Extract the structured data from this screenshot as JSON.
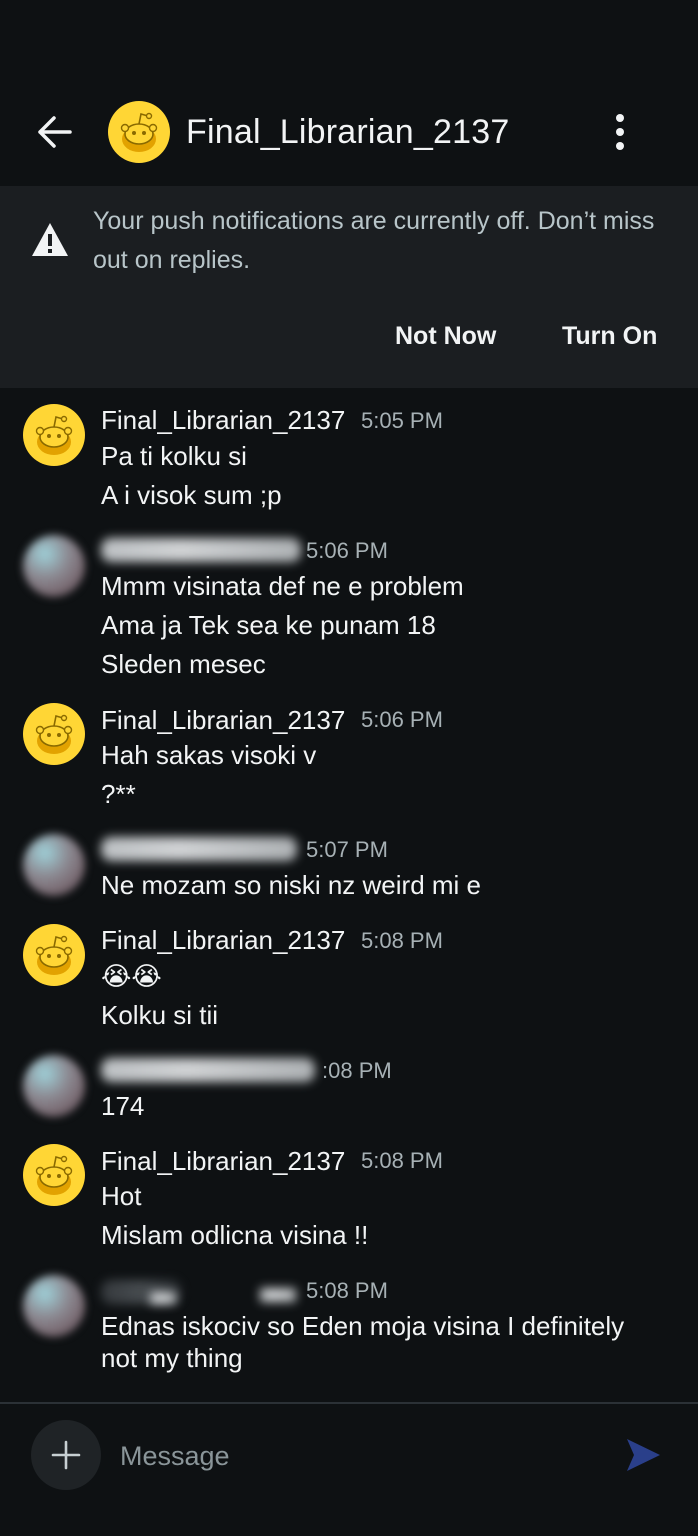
{
  "header": {
    "title": "Final_Librarian_2137",
    "back_icon": "arrow-left-icon",
    "more_icon": "kebab-menu-icon"
  },
  "notification_banner": {
    "text": "Your push notifications are currently off. Don’t miss out on replies.",
    "icon": "warning-icon",
    "not_now_label": "Not Now",
    "turn_on_label": "Turn On"
  },
  "messages": [
    {
      "sender": "Final_Librarian_2137",
      "time": "5:05 PM",
      "lines": [
        "Pa ti kolku si",
        "A i visok sum ;p"
      ]
    },
    {
      "sender": "",
      "time": "5:06 PM",
      "lines": [
        "Mmm visinata def ne e problem",
        "Ama ja Tek sea ke punam 18",
        "Sleden mesec"
      ]
    },
    {
      "sender": "Final_Librarian_2137",
      "time": "5:06 PM",
      "lines": [
        "Hah sakas visoki v",
        "?**"
      ]
    },
    {
      "sender": "",
      "time": "5:07 PM",
      "lines": [
        "Ne mozam so niski nz weird mi e"
      ]
    },
    {
      "sender": "Final_Librarian_2137",
      "time": "5:08 PM",
      "lines": [
        "😭😭",
        "Kolku si tii"
      ]
    },
    {
      "sender": "",
      "time": ":08 PM",
      "lines": [
        "174"
      ]
    },
    {
      "sender": "Final_Librarian_2137",
      "time": "5:08 PM",
      "lines": [
        "Hot",
        "Mislam odlicna visina !!"
      ]
    },
    {
      "sender": "",
      "time": "5:08 PM",
      "lines": [
        "Ednas iskociv so Eden moja visina I definitely",
        "not my thing"
      ]
    }
  ],
  "composer": {
    "placeholder": "Message",
    "add_icon": "plus-icon",
    "send_icon": "send-icon"
  },
  "colors": {
    "background": "#0e1113",
    "banner": "#1b1e21",
    "avatar_yellow": "#ffd635",
    "send_blue": "#2a3f8a"
  }
}
